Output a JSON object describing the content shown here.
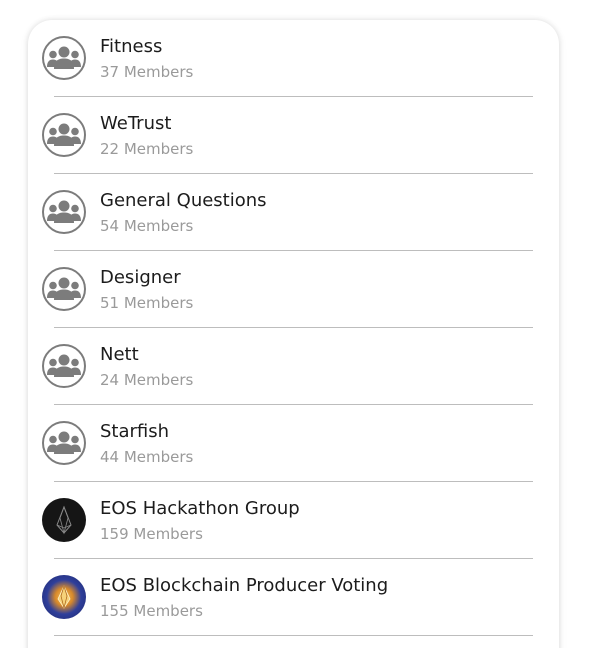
{
  "groups": [
    {
      "name": "Fitness",
      "members": "37 Members",
      "avatar": "group-icon"
    },
    {
      "name": "WeTrust",
      "members": "22 Members",
      "avatar": "group-icon"
    },
    {
      "name": "General Questions",
      "members": "54 Members",
      "avatar": "group-icon"
    },
    {
      "name": "Designer",
      "members": "51 Members",
      "avatar": "group-icon"
    },
    {
      "name": "Nett",
      "members": "24 Members",
      "avatar": "group-icon"
    },
    {
      "name": "Starfish",
      "members": "44 Members",
      "avatar": "group-icon"
    },
    {
      "name": "EOS Hackathon Group",
      "members": "159 Members",
      "avatar": "eos-logo-dark"
    },
    {
      "name": "EOS Blockchain Producer Voting",
      "members": "155 Members",
      "avatar": "eos-voting-logo"
    }
  ],
  "colors": {
    "name_text": "#1c1c1c",
    "members_text": "#9a9a9a",
    "divider": "#bdbdbd",
    "icon_gray": "#7c7c7c"
  }
}
